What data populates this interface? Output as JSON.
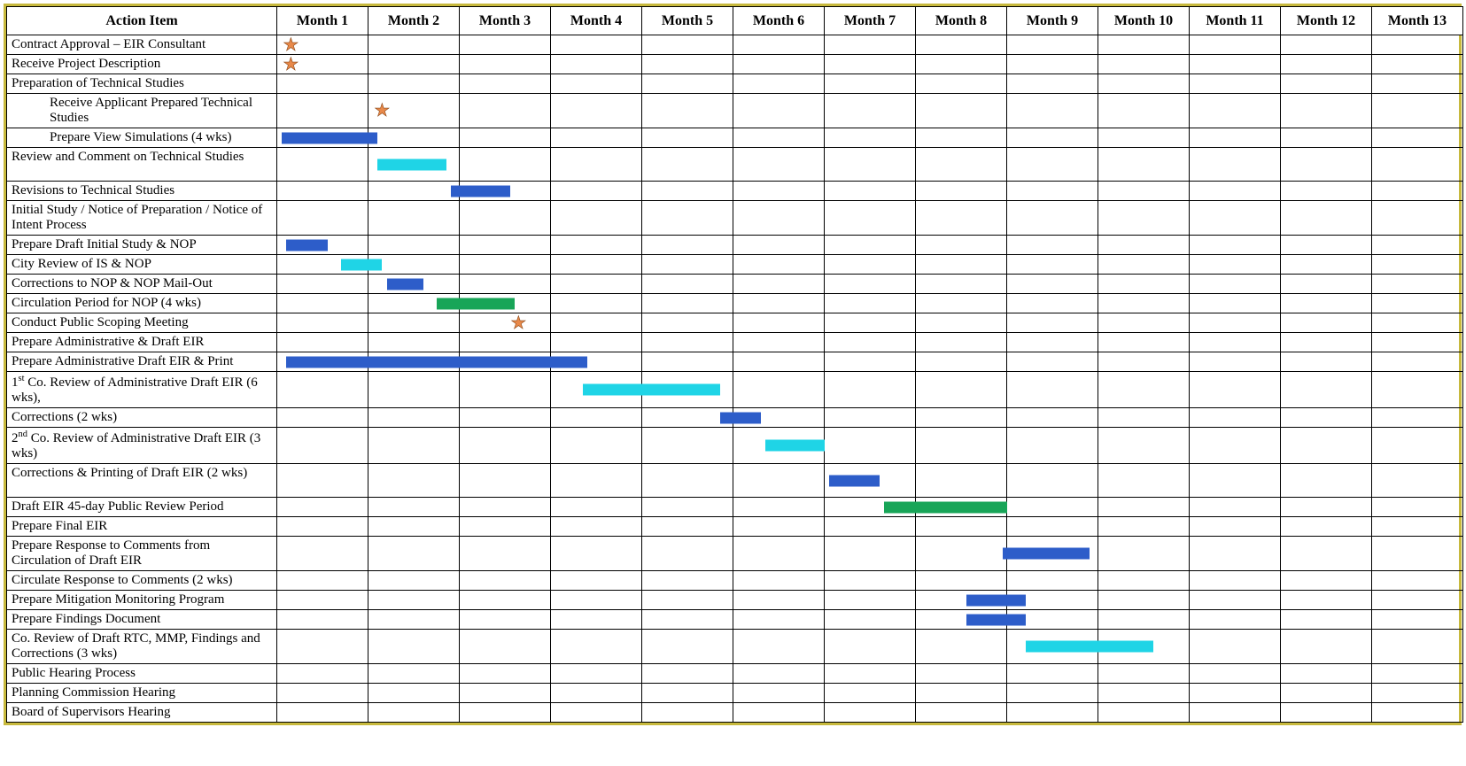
{
  "headers": {
    "action": "Action Item",
    "months": [
      "Month 1",
      "Month 2",
      "Month 3",
      "Month 4",
      "Month 5",
      "Month 6",
      "Month 7",
      "Month 8",
      "Month 9",
      "Month 10",
      "Month 11",
      "Month 12",
      "Month 13"
    ]
  },
  "rows": [
    {
      "label": "Contract Approval – EIR Consultant",
      "star": {
        "month": 1,
        "pos": 15
      }
    },
    {
      "label": "Receive Project Description",
      "star": {
        "month": 1,
        "pos": 15
      }
    },
    {
      "label": "Preparation of Technical Studies"
    },
    {
      "label": "Receive Applicant Prepared Technical Studies",
      "indent": true,
      "tall": true,
      "star": {
        "month": 2,
        "pos": 15
      }
    },
    {
      "label": "Prepare View Simulations (4 wks)",
      "indent": true,
      "bar": {
        "color": "blue",
        "start": 1.05,
        "end": 2.1
      }
    },
    {
      "label": "Review and Comment on Technical Studies",
      "tall": true,
      "bar": {
        "color": "cyan",
        "start": 2.1,
        "end": 2.85
      }
    },
    {
      "label": "Revisions to Technical Studies",
      "bar": {
        "color": "blue",
        "start": 2.9,
        "end": 3.55
      }
    },
    {
      "label": "Initial Study / Notice of Preparation / Notice of Intent Process",
      "tall": true
    },
    {
      "label": "Prepare Draft Initial Study & NOP",
      "bar": {
        "color": "blue",
        "start": 1.1,
        "end": 1.55
      }
    },
    {
      "label": "City Review of IS & NOP",
      "bar": {
        "color": "cyan",
        "start": 1.7,
        "end": 2.15
      }
    },
    {
      "label": "Corrections to NOP & NOP Mail-Out",
      "bar": {
        "color": "blue",
        "start": 2.2,
        "end": 2.6
      }
    },
    {
      "label": "Circulation Period for NOP  (4 wks)",
      "bar": {
        "color": "green",
        "start": 2.75,
        "end": 3.6
      }
    },
    {
      "label": "Conduct Public Scoping Meeting",
      "star": {
        "month": 3,
        "pos": 65
      }
    },
    {
      "label": "Prepare Administrative & Draft EIR"
    },
    {
      "label": "Prepare Administrative Draft EIR & Print",
      "bar": {
        "color": "blue",
        "start": 1.1,
        "end": 4.4
      }
    },
    {
      "label_html": "1<sup>st</sup> Co. Review of Administrative Draft EIR (6 wks),",
      "tall": true,
      "bar": {
        "color": "cyan",
        "start": 4.35,
        "end": 5.85
      }
    },
    {
      "label": "Corrections (2 wks)",
      "bar": {
        "color": "blue",
        "start": 5.85,
        "end": 6.3
      }
    },
    {
      "label_html": "2<sup>nd</sup> Co. Review of Administrative Draft EIR (3 wks)",
      "tall": true,
      "bar": {
        "color": "cyan",
        "start": 6.35,
        "end": 7.0
      }
    },
    {
      "label": "Corrections & Printing of Draft EIR (2 wks)",
      "tall": true,
      "bar": {
        "color": "blue",
        "start": 7.05,
        "end": 7.6
      }
    },
    {
      "label": "Draft EIR 45-day Public Review Period",
      "bar": {
        "color": "green",
        "start": 7.65,
        "end": 9.0
      }
    },
    {
      "label": "Prepare Final EIR"
    },
    {
      "label": "Prepare Response to Comments from Circulation of Draft EIR",
      "tall": true,
      "bar": {
        "color": "blue",
        "start": 8.95,
        "end": 9.9
      }
    },
    {
      "label": "Circulate Response to Comments (2 wks)"
    },
    {
      "label": "Prepare Mitigation Monitoring Program",
      "bar": {
        "color": "blue",
        "start": 8.55,
        "end": 9.2
      }
    },
    {
      "label": "Prepare Findings Document",
      "bar": {
        "color": "blue",
        "start": 8.55,
        "end": 9.2
      }
    },
    {
      "label": "Co. Review of Draft RTC, MMP, Findings and Corrections (3 wks)",
      "tall": true,
      "bar": {
        "color": "cyan",
        "start": 9.2,
        "end": 10.6
      }
    },
    {
      "label": "Public Hearing Process"
    },
    {
      "label": "Planning Commission Hearing"
    },
    {
      "label": "Board of Supervisors Hearing"
    }
  ],
  "chart_data": {
    "type": "gantt",
    "title": "",
    "x_unit": "month",
    "x_range": [
      1,
      14
    ],
    "categories": [
      "Month 1",
      "Month 2",
      "Month 3",
      "Month 4",
      "Month 5",
      "Month 6",
      "Month 7",
      "Month 8",
      "Month 9",
      "Month 10",
      "Month 11",
      "Month 12",
      "Month 13"
    ],
    "tasks": [
      {
        "name": "Contract Approval – EIR Consultant",
        "milestone": true,
        "at": 1.15
      },
      {
        "name": "Receive Project Description",
        "milestone": true,
        "at": 1.15
      },
      {
        "name": "Preparation of Technical Studies",
        "group": true
      },
      {
        "name": "Receive Applicant Prepared Technical Studies",
        "parent": "Preparation of Technical Studies",
        "milestone": true,
        "at": 2.15
      },
      {
        "name": "Prepare View Simulations (4 wks)",
        "parent": "Preparation of Technical Studies",
        "start": 1.05,
        "end": 2.1,
        "color": "blue"
      },
      {
        "name": "Review and Comment on Technical Studies",
        "start": 2.1,
        "end": 2.85,
        "color": "cyan"
      },
      {
        "name": "Revisions to Technical Studies",
        "start": 2.9,
        "end": 3.55,
        "color": "blue"
      },
      {
        "name": "Initial Study / Notice of Preparation / Notice of Intent Process",
        "group": true
      },
      {
        "name": "Prepare Draft Initial Study & NOP",
        "start": 1.1,
        "end": 1.55,
        "color": "blue"
      },
      {
        "name": "City Review of IS & NOP",
        "start": 1.7,
        "end": 2.15,
        "color": "cyan"
      },
      {
        "name": "Corrections to NOP & NOP Mail-Out",
        "start": 2.2,
        "end": 2.6,
        "color": "blue"
      },
      {
        "name": "Circulation Period for NOP (4 wks)",
        "start": 2.75,
        "end": 3.6,
        "color": "green"
      },
      {
        "name": "Conduct Public Scoping Meeting",
        "milestone": true,
        "at": 3.65
      },
      {
        "name": "Prepare Administrative & Draft EIR",
        "group": true
      },
      {
        "name": "Prepare Administrative Draft EIR & Print",
        "start": 1.1,
        "end": 4.4,
        "color": "blue"
      },
      {
        "name": "1st Co. Review of Administrative Draft EIR (6 wks)",
        "start": 4.35,
        "end": 5.85,
        "color": "cyan"
      },
      {
        "name": "Corrections (2 wks)",
        "start": 5.85,
        "end": 6.3,
        "color": "blue"
      },
      {
        "name": "2nd Co. Review of Administrative Draft EIR (3 wks)",
        "start": 6.35,
        "end": 7.0,
        "color": "cyan"
      },
      {
        "name": "Corrections & Printing of Draft EIR (2 wks)",
        "start": 7.05,
        "end": 7.6,
        "color": "blue"
      },
      {
        "name": "Draft EIR 45-day Public Review Period",
        "start": 7.65,
        "end": 9.0,
        "color": "green"
      },
      {
        "name": "Prepare Final EIR",
        "group": true
      },
      {
        "name": "Prepare Response to Comments from Circulation of Draft EIR",
        "start": 8.95,
        "end": 9.9,
        "color": "blue"
      },
      {
        "name": "Circulate Response to Comments (2 wks)"
      },
      {
        "name": "Prepare Mitigation Monitoring Program",
        "start": 8.55,
        "end": 9.2,
        "color": "blue"
      },
      {
        "name": "Prepare Findings Document",
        "start": 8.55,
        "end": 9.2,
        "color": "blue"
      },
      {
        "name": "Co. Review of Draft RTC, MMP, Findings and Corrections (3 wks)",
        "start": 9.2,
        "end": 10.6,
        "color": "cyan"
      },
      {
        "name": "Public Hearing Process",
        "group": true
      },
      {
        "name": "Planning Commission Hearing"
      },
      {
        "name": "Board of Supervisors Hearing"
      }
    ]
  }
}
